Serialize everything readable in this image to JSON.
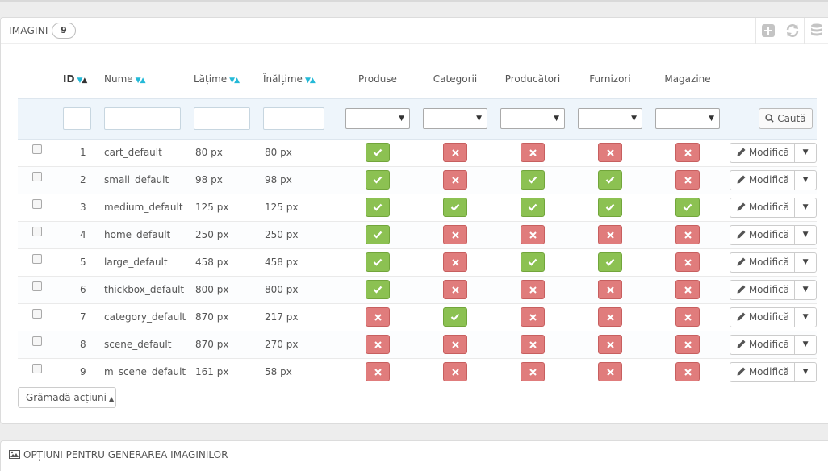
{
  "panel": {
    "title": "IMAGINI",
    "count": "9"
  },
  "columns": {
    "id": "ID",
    "name": "Nume",
    "width": "Lățime",
    "height": "Înălțime",
    "products": "Produse",
    "categories": "Categorii",
    "manufacturers": "Producători",
    "suppliers": "Furnizori",
    "stores": "Magazine"
  },
  "filters": {
    "select_placeholder": "-",
    "row_marker": "--",
    "search_label": "Caută"
  },
  "rows": [
    {
      "id": "1",
      "name": "cart_default",
      "width": "80 px",
      "height": "80 px",
      "flags": [
        true,
        false,
        false,
        false,
        false
      ]
    },
    {
      "id": "2",
      "name": "small_default",
      "width": "98 px",
      "height": "98 px",
      "flags": [
        true,
        false,
        true,
        true,
        false
      ]
    },
    {
      "id": "3",
      "name": "medium_default",
      "width": "125 px",
      "height": "125 px",
      "flags": [
        true,
        true,
        true,
        true,
        true
      ]
    },
    {
      "id": "4",
      "name": "home_default",
      "width": "250 px",
      "height": "250 px",
      "flags": [
        true,
        false,
        false,
        false,
        false
      ]
    },
    {
      "id": "5",
      "name": "large_default",
      "width": "458 px",
      "height": "458 px",
      "flags": [
        true,
        false,
        true,
        true,
        false
      ]
    },
    {
      "id": "6",
      "name": "thickbox_default",
      "width": "800 px",
      "height": "800 px",
      "flags": [
        true,
        false,
        false,
        false,
        false
      ]
    },
    {
      "id": "7",
      "name": "category_default",
      "width": "870 px",
      "height": "217 px",
      "flags": [
        false,
        true,
        false,
        false,
        false
      ]
    },
    {
      "id": "8",
      "name": "scene_default",
      "width": "870 px",
      "height": "270 px",
      "flags": [
        false,
        false,
        false,
        false,
        false
      ]
    },
    {
      "id": "9",
      "name": "m_scene_default",
      "width": "161 px",
      "height": "58 px",
      "flags": [
        false,
        false,
        false,
        false,
        false
      ]
    }
  ],
  "row_actions": {
    "edit_label": "Modifică"
  },
  "bulk": {
    "label": "Grămadă acțiuni"
  },
  "panel2": {
    "title": "OPȚIUNI PENTRU GENERAREA IMAGINILOR"
  },
  "icons": {
    "add": "add-icon",
    "refresh": "refresh-icon",
    "database": "database-icon",
    "search": "search-icon",
    "pencil": "pencil-icon",
    "check": "check-icon",
    "cross": "cross-icon",
    "image": "image-icon"
  },
  "colors": {
    "accent": "#25b9d7",
    "enabled": "#8cc152",
    "disabled": "#e07c7c",
    "filter_bg": "#eef5fb"
  }
}
